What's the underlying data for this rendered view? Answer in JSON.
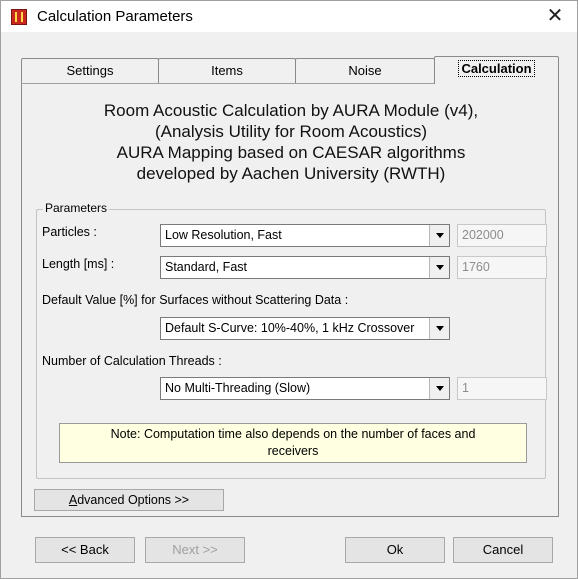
{
  "window": {
    "title": "Calculation Parameters",
    "close_glyph": "✕"
  },
  "tabs": [
    {
      "label": "Settings"
    },
    {
      "label": "Items"
    },
    {
      "label": "Noise"
    },
    {
      "label": "Calculation",
      "active": true
    }
  ],
  "intro": {
    "line1": "Room Acoustic Calculation by AURA Module (v4),",
    "line2": "(Analysis Utility for Room Acoustics)",
    "line3": "AURA Mapping based on CAESAR algorithms",
    "line4": "developed by Aachen University (RWTH)"
  },
  "parameters": {
    "group_title": "Parameters",
    "particles_label": "Particles :",
    "particles_value": "Low Resolution, Fast",
    "particles_count": "202000",
    "length_label": "Length [ms] :",
    "length_value": "Standard, Fast",
    "length_count": "1760",
    "scatter_label": "Default Value [%] for Surfaces without Scattering Data :",
    "scatter_value": "Default S-Curve: 10%-40%, 1 kHz Crossover",
    "threads_label": "Number of Calculation Threads :",
    "threads_value": "No Multi-Threading (Slow)",
    "threads_count": "1",
    "note_line1": "Note: Computation time also depends on the number of faces and",
    "note_line2": "receivers"
  },
  "advanced_button": {
    "underlined": "A",
    "rest": "dvanced Options >>"
  },
  "footer": {
    "back": "<< Back",
    "next": "Next >>",
    "ok": "Ok",
    "cancel": "Cancel"
  },
  "icons": {
    "app": "aura-app-icon",
    "close": "close-icon",
    "dropdown": "chevron-down-icon"
  }
}
